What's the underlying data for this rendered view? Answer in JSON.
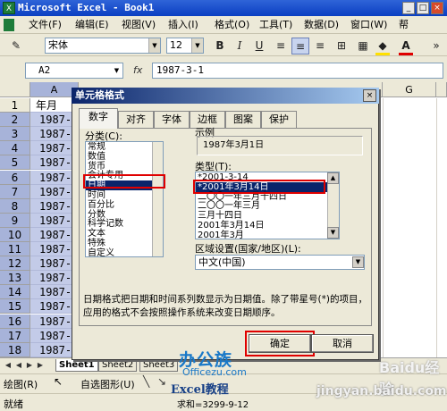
{
  "window": {
    "title": "Microsoft Excel - Book1",
    "minimize": "_",
    "restore": "□",
    "close": "×"
  },
  "menu": [
    "文件(F)",
    "编辑(E)",
    "视图(V)",
    "插入(I)",
    "格式(O)",
    "工具(T)",
    "数据(D)",
    "窗口(W)",
    "帮"
  ],
  "toolbar": {
    "font": "宋体",
    "size": "12",
    "bold": "B",
    "italic": "I",
    "underline": "U",
    "fill_color": "#ffe000",
    "font_color": "#e00000"
  },
  "formula_bar": {
    "cell_ref": "A2",
    "fx": "fx",
    "value": "1987-3-1"
  },
  "grid": {
    "col_a": "A",
    "col_g": "G",
    "rows": [
      "1",
      "2",
      "3",
      "4",
      "5",
      "6",
      "7",
      "8",
      "9",
      "10",
      "11",
      "12",
      "13",
      "14",
      "15",
      "16",
      "17",
      "18"
    ],
    "a_values": [
      "年月",
      "1987-",
      "1987-",
      "1987-",
      "1987-",
      "1987-",
      "1987-",
      "1987-",
      "1987-",
      "1987-",
      "1987-1",
      "1987-9",
      "1987-9",
      "1987-9",
      "1987-9",
      "1987-9",
      "1987-9",
      "1987-9"
    ]
  },
  "sheets": [
    "Sheet1",
    "Sheet2",
    "Sheet3"
  ],
  "drawbar": {
    "draw": "绘图(R)",
    "autoshapes": "自选图形(U)"
  },
  "status": {
    "ready": "就绪",
    "sum": "求和=3299-9-12"
  },
  "dialog": {
    "title": "单元格格式",
    "close": "×",
    "tabs": [
      "数字",
      "对齐",
      "字体",
      "边框",
      "图案",
      "保护"
    ],
    "category_label": "分类(C):",
    "categories": [
      "常规",
      "数值",
      "货币",
      "会计专用",
      "日期",
      "时间",
      "百分比",
      "分数",
      "科学记数",
      "文本",
      "特殊",
      "自定义"
    ],
    "sample_label": "示例",
    "sample_value": "1987年3月1日",
    "type_label": "类型(T):",
    "types": [
      "*2001-3-14",
      "*2001年3月14日",
      "二〇〇一年三月十四日",
      "二〇〇一年三月",
      "三月十四日",
      "2001年3月14日",
      "2001年3月"
    ],
    "locale_label": "区域设置(国家/地区)(L):",
    "locale_value": "中文(中国)",
    "description": "日期格式把日期和时间系列数显示为日期值。除了带星号(*)的项目，应用的格式不会按照操作系统来改变日期顺序。",
    "ok": "确定",
    "cancel": "取消"
  },
  "watermark": {
    "brand": "办公族",
    "site": "Officezu.com",
    "course": "Excel教程",
    "baidu": "Baidu经验",
    "jingyan": "jingyan.baidu.com"
  }
}
